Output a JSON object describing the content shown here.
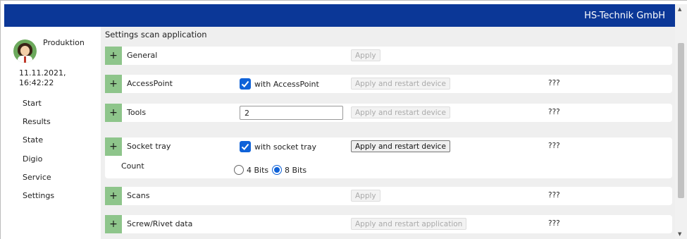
{
  "header": {
    "company": "HS-Technik GmbH"
  },
  "sidebar": {
    "user": "Produktion",
    "date": "11.11.2021,",
    "time": "16:42:22",
    "items": [
      {
        "label": "Start"
      },
      {
        "label": "Results"
      },
      {
        "label": "State"
      },
      {
        "label": "Digio"
      },
      {
        "label": "Service"
      },
      {
        "label": "Settings"
      }
    ]
  },
  "main": {
    "title": "Settings scan application",
    "rows": [
      {
        "label": "General",
        "button": "Apply",
        "status": ""
      },
      {
        "label": "AccessPoint",
        "checkbox_label": "with AccessPoint",
        "checked": true,
        "button": "Apply and restart device",
        "status": "???"
      },
      {
        "label": "Tools",
        "input_value": "2",
        "button": "Apply and restart device",
        "status": "???"
      },
      {
        "label": "Socket tray",
        "checkbox_label": "with socket tray",
        "checked": true,
        "button": "Apply and restart device",
        "status": "???"
      },
      {
        "label": "Scans",
        "button": "Apply",
        "status": "???"
      },
      {
        "label": "Screw/Rivet data",
        "button": "Apply and restart application",
        "status": "???"
      }
    ],
    "count": {
      "label": "Count",
      "options": [
        {
          "label": "4 Bits",
          "selected": false
        },
        {
          "label": "8 Bits",
          "selected": true
        }
      ]
    },
    "plus_symbol": "+"
  },
  "colors": {
    "header_bg": "#0b3797",
    "plus_bg": "#8ec58b",
    "checkbox": "#0f62d8"
  }
}
